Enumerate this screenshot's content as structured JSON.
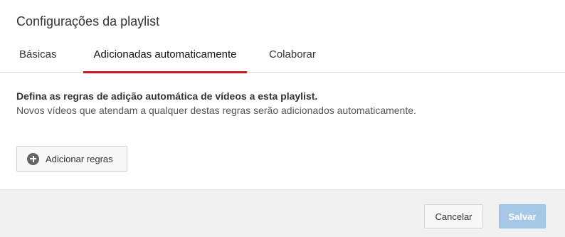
{
  "dialog": {
    "title": "Configurações da playlist"
  },
  "tabs": [
    {
      "label": "Básicas",
      "active": false
    },
    {
      "label": "Adicionadas automaticamente",
      "active": true
    },
    {
      "label": "Colaborar",
      "active": false
    }
  ],
  "content": {
    "description_bold": "Defina as regras de adição automática de vídeos a esta playlist.",
    "description_normal": "Novos vídeos que atendam a qualquer destas regras serão adicionados automaticamente.",
    "add_rules_label": "Adicionar regras",
    "add_rules_icon": "plus-circle-icon"
  },
  "footer": {
    "cancel_label": "Cancelar",
    "save_label": "Salvar"
  },
  "colors": {
    "active_tab_underline": "#cc181e",
    "save_button_bg": "#a6c8e7",
    "footer_bg": "#f1f1f1"
  }
}
